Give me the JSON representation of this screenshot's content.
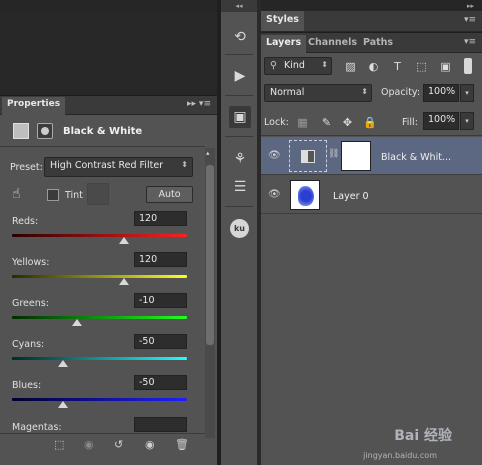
{
  "properties": {
    "tab": "Properties",
    "menu": "▸▸ ▾≡",
    "title": "Black & White",
    "preset_label": "Preset:",
    "preset_value": "High Contrast Red Filter",
    "tint_label": "Tint",
    "auto_label": "Auto",
    "sliders": [
      {
        "label": "Reds:",
        "value": "120",
        "fraction": 0.64
      },
      {
        "label": "Yellows:",
        "value": "120",
        "fraction": 0.64
      },
      {
        "label": "Greens:",
        "value": "-10",
        "fraction": 0.37
      },
      {
        "label": "Cyans:",
        "value": "-50",
        "fraction": 0.29
      },
      {
        "label": "Blues:",
        "value": "-50",
        "fraction": 0.29
      },
      {
        "label": "Magentas:",
        "value": ""
      }
    ],
    "slider_gradients": [
      "linear-gradient(90deg,#2a0000,#ff2020)",
      "linear-gradient(90deg,#2a2a00,#ffff20)",
      "linear-gradient(90deg,#002a00,#20ff20)",
      "linear-gradient(90deg,#002a2a,#20ffff)",
      "linear-gradient(90deg,#00002a,#2020ff)"
    ]
  },
  "strip": {
    "collapse": "◂◂"
  },
  "styles": {
    "tab": "Styles",
    "menu": "▾≡",
    "collapse": "▸▸"
  },
  "layers": {
    "tabs": [
      "Layers",
      "Channels",
      "Paths"
    ],
    "menu": "▾≡",
    "kind_label": "Kind",
    "blend_mode": "Normal",
    "opacity_label": "Opacity:",
    "opacity_value": "100%",
    "lock_label": "Lock:",
    "fill_label": "Fill:",
    "fill_value": "100%",
    "items": [
      {
        "name": "Black & Whit..."
      },
      {
        "name": "Layer 0"
      }
    ]
  },
  "watermark": {
    "brand": "Bai 经验",
    "url": "jingyan.baidu.com"
  }
}
